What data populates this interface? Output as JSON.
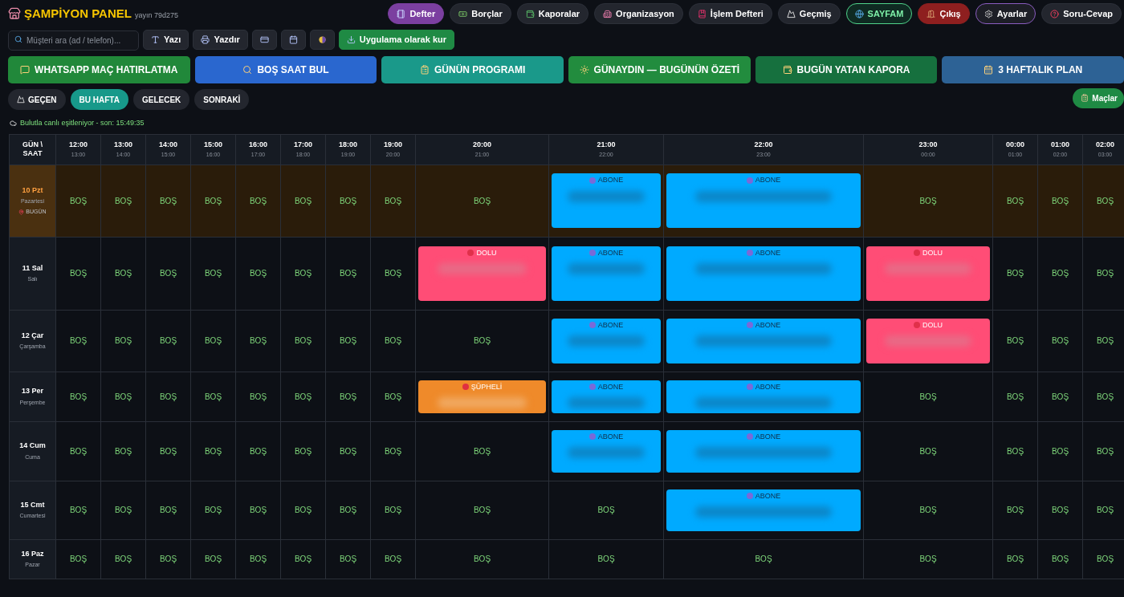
{
  "header": {
    "title": "ŞAMPİYON PANEL",
    "version": "yayın 79d275"
  },
  "nav": [
    {
      "label": "Defter",
      "kind": "primary"
    },
    {
      "label": "Borçlar",
      "kind": "plain"
    },
    {
      "label": "Kaporalar",
      "kind": "plain"
    },
    {
      "label": "Organizasyon",
      "kind": "plain"
    },
    {
      "label": "İşlem Defteri",
      "kind": "plain"
    },
    {
      "label": "Geçmiş",
      "kind": "plain"
    },
    {
      "label": "SAYFAM",
      "kind": "highlight"
    },
    {
      "label": "Çıkış",
      "kind": "danger"
    },
    {
      "label": "Ayarlar",
      "kind": "outline"
    },
    {
      "label": "Soru-Cevap",
      "kind": "plain"
    }
  ],
  "search": {
    "placeholder": "Müşteri ara (ad / telefon)..."
  },
  "tools": [
    {
      "label": "Yazı",
      "kind": "plain"
    },
    {
      "label": "Yazdır",
      "kind": "plain"
    },
    {
      "kind": "icon"
    },
    {
      "kind": "icon"
    },
    {
      "kind": "icon"
    },
    {
      "label": "Uygulama olarak kur",
      "kind": "install"
    }
  ],
  "actions": [
    {
      "label": "WHATSAPP MAÇ HATIRLATMA",
      "color": "#21883a"
    },
    {
      "label": "BOŞ SAAT BUL",
      "color": "#2a67cf"
    },
    {
      "label": "GÜNÜN PROGRAMI",
      "color": "#1a998a"
    },
    {
      "label": "GÜNAYDIN — BUGÜNÜN ÖZETİ",
      "color": "#228c3e"
    },
    {
      "label": "BUGÜN YATAN KAPORA",
      "color": "#16703e"
    },
    {
      "label": "3 HAFTALIK PLAN",
      "color": "#2d6295"
    }
  ],
  "weeks": [
    {
      "label": "GEÇEN",
      "selected": false
    },
    {
      "label": "BU HAFTA",
      "selected": true
    },
    {
      "label": "GELECEK",
      "selected": false
    },
    {
      "label": "SONRAKİ",
      "selected": false
    }
  ],
  "matches_button": "Maçlar",
  "sync_status": "Bulutla canlı eşitleniyor - son: 15:49:35",
  "table": {
    "corner": "GÜN \\ SAAT",
    "columns": [
      {
        "start": "12:00",
        "end": "13:00"
      },
      {
        "start": "13:00",
        "end": "14:00"
      },
      {
        "start": "14:00",
        "end": "15:00"
      },
      {
        "start": "15:00",
        "end": "16:00"
      },
      {
        "start": "16:00",
        "end": "17:00"
      },
      {
        "start": "17:00",
        "end": "18:00"
      },
      {
        "start": "18:00",
        "end": "19:00"
      },
      {
        "start": "19:00",
        "end": "20:00"
      },
      {
        "start": "20:00",
        "end": "21:00"
      },
      {
        "start": "21:00",
        "end": "22:00"
      },
      {
        "start": "22:00",
        "end": "23:00"
      },
      {
        "start": "23:00",
        "end": "00:00"
      },
      {
        "start": "00:00",
        "end": "01:00"
      },
      {
        "start": "01:00",
        "end": "02:00"
      },
      {
        "start": "02:00",
        "end": "03:00"
      }
    ],
    "rows": [
      {
        "day": "10 Pzt",
        "weekday": "Pazartesi",
        "today": true,
        "today_label": "BUGÜN",
        "cells": [
          {
            "kind": "free",
            "text": "BOŞ"
          },
          {
            "kind": "free",
            "text": "BOŞ"
          },
          {
            "kind": "free",
            "text": "BOŞ"
          },
          {
            "kind": "free",
            "text": "BOŞ"
          },
          {
            "kind": "free",
            "text": "BOŞ"
          },
          {
            "kind": "free",
            "text": "BOŞ"
          },
          {
            "kind": "free",
            "text": "BOŞ"
          },
          {
            "kind": "free",
            "text": "BOŞ"
          },
          {
            "kind": "free",
            "text": "BOŞ"
          },
          {
            "kind": "subscriber",
            "text": "ABONE"
          },
          {
            "kind": "subscriber",
            "text": "ABONE"
          },
          {
            "kind": "free",
            "text": "BOŞ"
          },
          {
            "kind": "free",
            "text": "BOŞ"
          },
          {
            "kind": "free",
            "text": "BOŞ"
          },
          {
            "kind": "free",
            "text": "BOŞ"
          }
        ]
      },
      {
        "day": "11 Sal",
        "weekday": "Salı",
        "today": false,
        "cells": [
          {
            "kind": "free",
            "text": "BOŞ"
          },
          {
            "kind": "free",
            "text": "BOŞ"
          },
          {
            "kind": "free",
            "text": "BOŞ"
          },
          {
            "kind": "free",
            "text": "BOŞ"
          },
          {
            "kind": "free",
            "text": "BOŞ"
          },
          {
            "kind": "free",
            "text": "BOŞ"
          },
          {
            "kind": "free",
            "text": "BOŞ"
          },
          {
            "kind": "free",
            "text": "BOŞ"
          },
          {
            "kind": "full",
            "text": "DOLU"
          },
          {
            "kind": "subscriber",
            "text": "ABONE"
          },
          {
            "kind": "subscriber",
            "text": "ABONE"
          },
          {
            "kind": "full",
            "text": "DOLU"
          },
          {
            "kind": "free",
            "text": "BOŞ"
          },
          {
            "kind": "free",
            "text": "BOŞ"
          },
          {
            "kind": "free",
            "text": "BOŞ"
          }
        ]
      },
      {
        "day": "12 Çar",
        "weekday": "Çarşamba",
        "today": false,
        "cells": [
          {
            "kind": "free",
            "text": "BOŞ"
          },
          {
            "kind": "free",
            "text": "BOŞ"
          },
          {
            "kind": "free",
            "text": "BOŞ"
          },
          {
            "kind": "free",
            "text": "BOŞ"
          },
          {
            "kind": "free",
            "text": "BOŞ"
          },
          {
            "kind": "free",
            "text": "BOŞ"
          },
          {
            "kind": "free",
            "text": "BOŞ"
          },
          {
            "kind": "free",
            "text": "BOŞ"
          },
          {
            "kind": "free",
            "text": "BOŞ"
          },
          {
            "kind": "subscriber",
            "text": "ABONE"
          },
          {
            "kind": "subscriber",
            "text": "ABONE"
          },
          {
            "kind": "full",
            "text": "DOLU"
          },
          {
            "kind": "free",
            "text": "BOŞ"
          },
          {
            "kind": "free",
            "text": "BOŞ"
          },
          {
            "kind": "free",
            "text": "BOŞ"
          }
        ]
      },
      {
        "day": "13 Per",
        "weekday": "Perşembe",
        "today": false,
        "cells": [
          {
            "kind": "free",
            "text": "BOŞ"
          },
          {
            "kind": "free",
            "text": "BOŞ"
          },
          {
            "kind": "free",
            "text": "BOŞ"
          },
          {
            "kind": "free",
            "text": "BOŞ"
          },
          {
            "kind": "free",
            "text": "BOŞ"
          },
          {
            "kind": "free",
            "text": "BOŞ"
          },
          {
            "kind": "free",
            "text": "BOŞ"
          },
          {
            "kind": "free",
            "text": "BOŞ"
          },
          {
            "kind": "suspect",
            "text": "ŞÜPHELİ"
          },
          {
            "kind": "subscriber",
            "text": "ABONE"
          },
          {
            "kind": "subscriber",
            "text": "ABONE"
          },
          {
            "kind": "free",
            "text": "BOŞ"
          },
          {
            "kind": "free",
            "text": "BOŞ"
          },
          {
            "kind": "free",
            "text": "BOŞ"
          },
          {
            "kind": "free",
            "text": "BOŞ"
          }
        ]
      },
      {
        "day": "14 Cum",
        "weekday": "Cuma",
        "today": false,
        "cells": [
          {
            "kind": "free",
            "text": "BOŞ"
          },
          {
            "kind": "free",
            "text": "BOŞ"
          },
          {
            "kind": "free",
            "text": "BOŞ"
          },
          {
            "kind": "free",
            "text": "BOŞ"
          },
          {
            "kind": "free",
            "text": "BOŞ"
          },
          {
            "kind": "free",
            "text": "BOŞ"
          },
          {
            "kind": "free",
            "text": "BOŞ"
          },
          {
            "kind": "free",
            "text": "BOŞ"
          },
          {
            "kind": "free",
            "text": "BOŞ"
          },
          {
            "kind": "subscriber",
            "text": "ABONE"
          },
          {
            "kind": "subscriber",
            "text": "ABONE"
          },
          {
            "kind": "free",
            "text": "BOŞ"
          },
          {
            "kind": "free",
            "text": "BOŞ"
          },
          {
            "kind": "free",
            "text": "BOŞ"
          },
          {
            "kind": "free",
            "text": "BOŞ"
          }
        ]
      },
      {
        "day": "15 Cmt",
        "weekday": "Cumartesi",
        "today": false,
        "cells": [
          {
            "kind": "free",
            "text": "BOŞ"
          },
          {
            "kind": "free",
            "text": "BOŞ"
          },
          {
            "kind": "free",
            "text": "BOŞ"
          },
          {
            "kind": "free",
            "text": "BOŞ"
          },
          {
            "kind": "free",
            "text": "BOŞ"
          },
          {
            "kind": "free",
            "text": "BOŞ"
          },
          {
            "kind": "free",
            "text": "BOŞ"
          },
          {
            "kind": "free",
            "text": "BOŞ"
          },
          {
            "kind": "free",
            "text": "BOŞ"
          },
          {
            "kind": "free",
            "text": "BOŞ"
          },
          {
            "kind": "subscriber",
            "text": "ABONE"
          },
          {
            "kind": "free",
            "text": "BOŞ"
          },
          {
            "kind": "free",
            "text": "BOŞ"
          },
          {
            "kind": "free",
            "text": "BOŞ"
          },
          {
            "kind": "free",
            "text": "BOŞ"
          }
        ]
      },
      {
        "day": "16 Paz",
        "weekday": "Pazar",
        "today": false,
        "cells": [
          {
            "kind": "free",
            "text": "BOŞ"
          },
          {
            "kind": "free",
            "text": "BOŞ"
          },
          {
            "kind": "free",
            "text": "BOŞ"
          },
          {
            "kind": "free",
            "text": "BOŞ"
          },
          {
            "kind": "free",
            "text": "BOŞ"
          },
          {
            "kind": "free",
            "text": "BOŞ"
          },
          {
            "kind": "free",
            "text": "BOŞ"
          },
          {
            "kind": "free",
            "text": "BOŞ"
          },
          {
            "kind": "free",
            "text": "BOŞ"
          },
          {
            "kind": "free",
            "text": "BOŞ"
          },
          {
            "kind": "free",
            "text": "BOŞ"
          },
          {
            "kind": "free",
            "text": "BOŞ"
          },
          {
            "kind": "free",
            "text": "BOŞ"
          },
          {
            "kind": "free",
            "text": "BOŞ"
          },
          {
            "kind": "free",
            "text": "BOŞ"
          }
        ]
      }
    ]
  }
}
